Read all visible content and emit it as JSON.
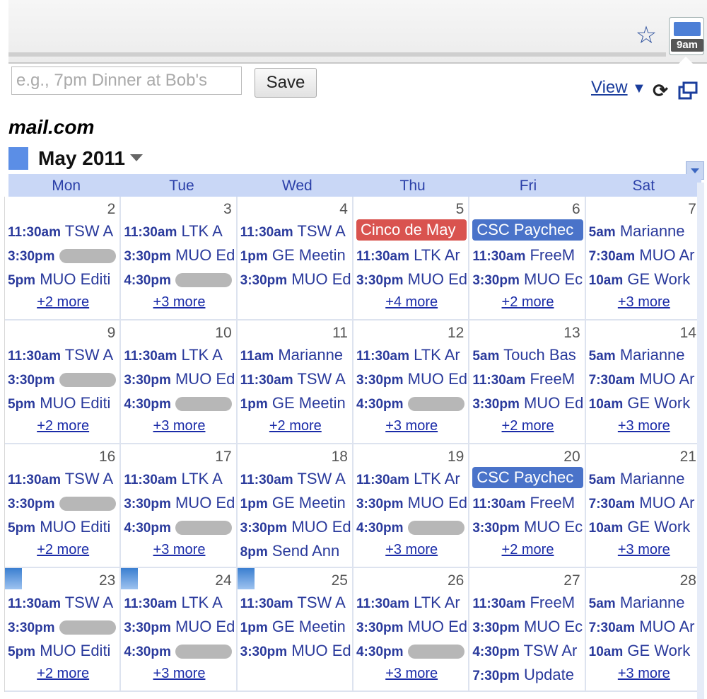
{
  "chrome": {
    "star_icon": "star-icon",
    "extension_badge": "9am",
    "extension_icon": "calendar-icon"
  },
  "popup": {
    "quick_add_placeholder": "e.g., 7pm Dinner at Bob's",
    "save_label": "Save",
    "view_label": "View",
    "refresh_icon": "refresh-icon",
    "popout_icon": "popout-icon"
  },
  "account": "mail.com",
  "month_title": "May 2011",
  "days_of_week": [
    "Mon",
    "Tue",
    "Wed",
    "Thu",
    "Fri",
    "Sat"
  ],
  "colors": {
    "header_bg": "#c9d7f6",
    "event_text": "#2a3a9c",
    "chip_red": "#d9534f",
    "chip_blue": "#4a73c9",
    "accent": "#5b8ee6"
  },
  "weeks": [
    [
      {
        "day": "2",
        "events": [
          {
            "time": "11:30am",
            "title": "TSW A"
          },
          {
            "time": "3:30pm",
            "title": "",
            "blurred": true
          },
          {
            "time": "5pm",
            "title": "MUO Editi"
          }
        ],
        "more": "+2 more"
      },
      {
        "day": "3",
        "events": [
          {
            "time": "11:30am",
            "title": "LTK A"
          },
          {
            "time": "3:30pm",
            "title": "MUO Ed"
          },
          {
            "time": "4:30pm",
            "title": "",
            "blurred": true
          }
        ],
        "more": "+3 more"
      },
      {
        "day": "4",
        "events": [
          {
            "time": "11:30am",
            "title": "TSW A"
          },
          {
            "time": "1pm",
            "title": "GE Meetin"
          },
          {
            "time": "3:30pm",
            "title": "MUO Ed"
          }
        ],
        "more": ""
      },
      {
        "day": "5",
        "chips": [
          {
            "title": "Cinco de May",
            "color": "#d9534f"
          }
        ],
        "events": [
          {
            "time": "11:30am",
            "title": "LTK Ar"
          },
          {
            "time": "3:30pm",
            "title": "MUO Ed"
          }
        ],
        "more": "+4 more"
      },
      {
        "day": "6",
        "chips": [
          {
            "title": "CSC Paychec",
            "color": "#4a73c9"
          }
        ],
        "events": [
          {
            "time": "11:30am",
            "title": "FreeM"
          },
          {
            "time": "3:30pm",
            "title": "MUO Ec"
          }
        ],
        "more": "+2 more"
      },
      {
        "day": "7",
        "events": [
          {
            "time": "5am",
            "title": "Marianne"
          },
          {
            "time": "7:30am",
            "title": "MUO Ar"
          },
          {
            "time": "10am",
            "title": "GE Work"
          }
        ],
        "more": "+3 more"
      }
    ],
    [
      {
        "day": "9",
        "events": [
          {
            "time": "11:30am",
            "title": "TSW A"
          },
          {
            "time": "3:30pm",
            "title": "",
            "blurred": true
          },
          {
            "time": "5pm",
            "title": "MUO Editi"
          }
        ],
        "more": "+2 more"
      },
      {
        "day": "10",
        "events": [
          {
            "time": "11:30am",
            "title": "LTK A"
          },
          {
            "time": "3:30pm",
            "title": "MUO Ed"
          },
          {
            "time": "4:30pm",
            "title": "",
            "blurred": true
          }
        ],
        "more": "+3 more"
      },
      {
        "day": "11",
        "events": [
          {
            "time": "11am",
            "title": "Marianne"
          },
          {
            "time": "11:30am",
            "title": "TSW A"
          },
          {
            "time": "1pm",
            "title": "GE Meetin"
          }
        ],
        "more": "+2 more"
      },
      {
        "day": "12",
        "events": [
          {
            "time": "11:30am",
            "title": "LTK Ar"
          },
          {
            "time": "3:30pm",
            "title": "MUO Ed"
          },
          {
            "time": "4:30pm",
            "title": "",
            "blurred": true
          }
        ],
        "more": "+3 more"
      },
      {
        "day": "13",
        "events": [
          {
            "time": "5am",
            "title": "Touch Bas"
          },
          {
            "time": "11:30am",
            "title": "FreeM"
          },
          {
            "time": "3:30pm",
            "title": "MUO Ed"
          }
        ],
        "more": "+2 more"
      },
      {
        "day": "14",
        "events": [
          {
            "time": "5am",
            "title": "Marianne"
          },
          {
            "time": "7:30am",
            "title": "MUO Ar"
          },
          {
            "time": "10am",
            "title": "GE Work"
          }
        ],
        "more": "+3 more"
      }
    ],
    [
      {
        "day": "16",
        "events": [
          {
            "time": "11:30am",
            "title": "TSW A"
          },
          {
            "time": "3:30pm",
            "title": "",
            "blurred": true
          },
          {
            "time": "5pm",
            "title": "MUO Editi"
          }
        ],
        "more": "+2 more"
      },
      {
        "day": "17",
        "events": [
          {
            "time": "11:30am",
            "title": "LTK A"
          },
          {
            "time": "3:30pm",
            "title": "MUO Ed"
          },
          {
            "time": "4:30pm",
            "title": "",
            "blurred": true
          }
        ],
        "more": "+3 more"
      },
      {
        "day": "18",
        "events": [
          {
            "time": "11:30am",
            "title": "TSW A"
          },
          {
            "time": "1pm",
            "title": "GE Meetin"
          },
          {
            "time": "3:30pm",
            "title": "MUO Ed"
          },
          {
            "time": "8pm",
            "title": "Send Ann"
          }
        ],
        "more": ""
      },
      {
        "day": "19",
        "events": [
          {
            "time": "11:30am",
            "title": "LTK Ar"
          },
          {
            "time": "3:30pm",
            "title": "MUO Ed"
          },
          {
            "time": "4:30pm",
            "title": "",
            "blurred": true
          }
        ],
        "more": "+3 more"
      },
      {
        "day": "20",
        "chips": [
          {
            "title": "CSC Paychec",
            "color": "#4a73c9"
          }
        ],
        "events": [
          {
            "time": "11:30am",
            "title": "FreeM"
          },
          {
            "time": "3:30pm",
            "title": "MUO Ec"
          }
        ],
        "more": "+2 more"
      },
      {
        "day": "21",
        "events": [
          {
            "time": "5am",
            "title": "Marianne"
          },
          {
            "time": "7:30am",
            "title": "MUO Ar"
          },
          {
            "time": "10am",
            "title": "GE Work"
          }
        ],
        "more": "+3 more"
      }
    ],
    [
      {
        "day": "23",
        "weather": true,
        "events": [
          {
            "time": "11:30am",
            "title": "TSW A"
          },
          {
            "time": "3:30pm",
            "title": "",
            "blurred": true
          },
          {
            "time": "5pm",
            "title": "MUO Editi"
          }
        ],
        "more": "+2 more"
      },
      {
        "day": "24",
        "weather": true,
        "events": [
          {
            "time": "11:30am",
            "title": "LTK A"
          },
          {
            "time": "3:30pm",
            "title": "MUO Ed"
          },
          {
            "time": "4:30pm",
            "title": "",
            "blurred": true
          }
        ],
        "more": "+3 more"
      },
      {
        "day": "25",
        "weather": true,
        "events": [
          {
            "time": "11:30am",
            "title": "TSW A"
          },
          {
            "time": "1pm",
            "title": "GE Meetin"
          },
          {
            "time": "3:30pm",
            "title": "MUO Ed"
          }
        ],
        "more": ""
      },
      {
        "day": "26",
        "events": [
          {
            "time": "11:30am",
            "title": "LTK Ar"
          },
          {
            "time": "3:30pm",
            "title": "MUO Ed"
          },
          {
            "time": "4:30pm",
            "title": "",
            "blurred": true
          }
        ],
        "more": "+3 more"
      },
      {
        "day": "27",
        "events": [
          {
            "time": "11:30am",
            "title": "FreeM"
          },
          {
            "time": "3:30pm",
            "title": "MUO Ec"
          },
          {
            "time": "4:30pm",
            "title": "TSW Ar"
          },
          {
            "time": "7:30pm",
            "title": "Update"
          }
        ],
        "more": ""
      },
      {
        "day": "28",
        "events": [
          {
            "time": "5am",
            "title": "Marianne"
          },
          {
            "time": "7:30am",
            "title": "MUO Ar"
          },
          {
            "time": "10am",
            "title": "GE Work"
          }
        ],
        "more": "+3 more"
      }
    ]
  ]
}
